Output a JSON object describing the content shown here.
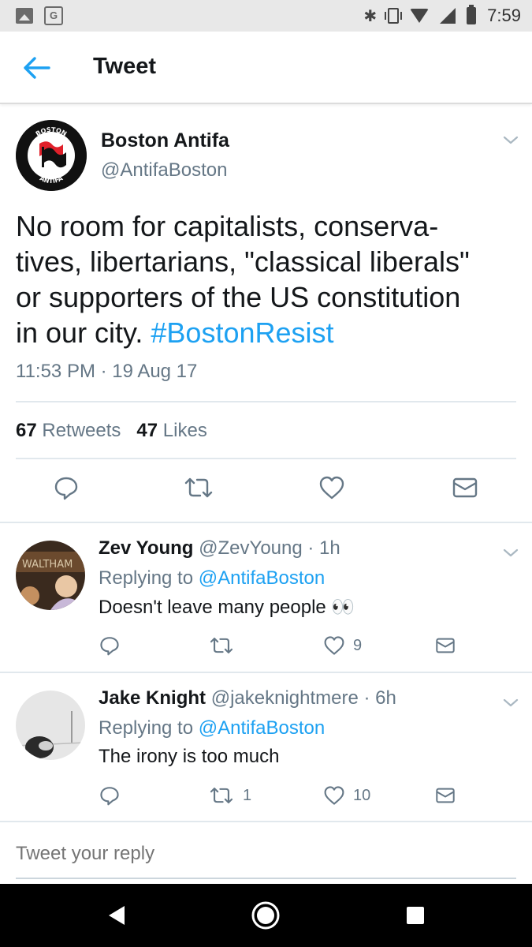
{
  "status_bar": {
    "time": "7:59",
    "maps_label": "G"
  },
  "header": {
    "title": "Tweet"
  },
  "main_tweet": {
    "name": "Boston Antifa",
    "handle": "@AntifaBoston",
    "avatar_text_top": "BOSTON",
    "avatar_text_bottom": "ANTIFA",
    "text_lines": [
      "No room for capitalists, conserva-",
      "tives, libertarians, \"classical liberals\"",
      "or supporters of the US constitution",
      "in our city. "
    ],
    "hashtag": "#BostonResist",
    "timestamp": "11:53 PM · 19 Aug 17",
    "retweets_count": "67",
    "retweets_label": "Retweets",
    "likes_count": "47",
    "likes_label": "Likes"
  },
  "replies": [
    {
      "name": "Zev Young",
      "meta": " @ZevYoung · 1h",
      "replying_prefix": "Replying to ",
      "replying_to": "@AntifaBoston",
      "text": "Doesn't leave many people 👀",
      "avatar_text": "WALTHAM",
      "retweets": "",
      "likes": "9"
    },
    {
      "name": "Jake Knight",
      "meta": " @jakeknightmere · 6h",
      "replying_prefix": "Replying to ",
      "replying_to": "@AntifaBoston",
      "text": "The irony is too much",
      "retweets": "1",
      "likes": "10"
    }
  ],
  "reply_box": {
    "placeholder": "Tweet your reply"
  },
  "colors": {
    "accent": "#1da1f2",
    "secondary_text": "#657786",
    "divider": "#e1e8ed"
  }
}
